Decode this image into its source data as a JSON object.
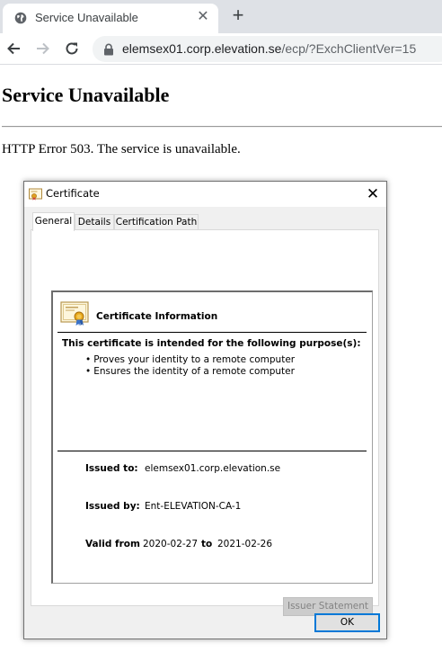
{
  "browser": {
    "tab_title": "Service Unavailable",
    "tab_close_glyph": "✕",
    "new_tab_glyph": "+",
    "url_host": "elemsex01.corp.elevation.se",
    "url_path": "/ecp/?ExchClientVer=15",
    "icons": [
      "globe-icon",
      "close-icon",
      "plus-icon",
      "back-arrow-icon",
      "forward-arrow-icon",
      "reload-icon",
      "lock-icon"
    ]
  },
  "page": {
    "title": "Service Unavailable",
    "error": "HTTP Error 503. The service is unavailable."
  },
  "dialog": {
    "title": "Certificate",
    "close_glyph": "✕",
    "tabs": [
      "General",
      "Details",
      "Certification Path"
    ],
    "selected_tab": "General",
    "info_heading": "Certificate Information",
    "purpose_heading": "This certificate is intended for the following purpose(s):",
    "purposes": [
      "Proves your identity to a remote computer",
      "Ensures the identity of a remote computer"
    ],
    "issued_to_label": "Issued to:",
    "issued_to": "elemsex01.corp.elevation.se",
    "issued_by_label": "Issued by:",
    "issued_by": "Ent-ELEVATION-CA-1",
    "valid_from_label": "Valid from",
    "valid_from": "2020-02-27",
    "valid_to_label": "to",
    "valid_to": "2021-02-26",
    "issuer_statement_button": "Issuer Statement",
    "ok_button": "OK"
  },
  "colors": {
    "tabstrip": "#dee1e6",
    "omnibox": "#f1f3f4",
    "dialog_bg": "#f0f0f0",
    "ok_border": "#0078d7",
    "disabled_text": "#838383"
  }
}
